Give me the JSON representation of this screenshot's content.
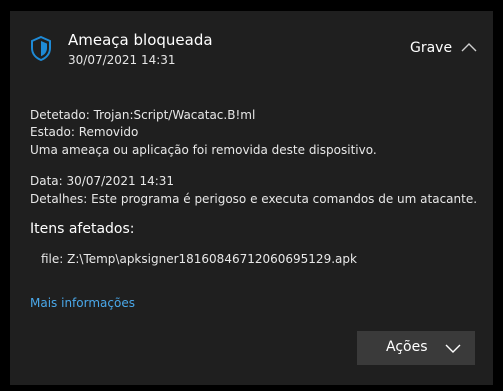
{
  "header": {
    "title": "Ameaça bloqueada",
    "timestamp": "30/07/2021 14:31",
    "severity": "Grave",
    "accent_color": "#1e8ad6"
  },
  "details": {
    "detected": "Detetado:  Trojan:Script/Wacatac.B!ml",
    "status": "Estado:  Removido",
    "message": "Uma ameaça ou aplicação foi removida deste dispositivo.",
    "date": "Data:  30/07/2021 14:31",
    "description": "Detalhes:  Este programa é perigoso e executa comandos de um atacante."
  },
  "affected": {
    "title": "Itens afetados:",
    "file": "file: Z:\\Temp\\apksigner1816084671206069512​9.apk"
  },
  "links": {
    "more_info": "Mais informações",
    "link_color": "#4aa8ea"
  },
  "actions": {
    "label": "Ações"
  },
  "icons": {
    "shield": "shield-icon",
    "collapse": "chevron-up-icon",
    "dropdown": "chevron-down-icon"
  }
}
